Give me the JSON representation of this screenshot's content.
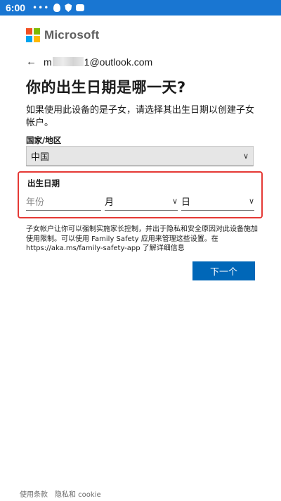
{
  "status_bar": {
    "time": "6:00"
  },
  "brand": {
    "name": "Microsoft",
    "colors": {
      "red": "#f25022",
      "green": "#7fba00",
      "blue": "#00a4ef",
      "yellow": "#ffb900"
    }
  },
  "account": {
    "email_prefix": "m",
    "email_suffix": "1@outlook.com"
  },
  "page": {
    "title": "你的出生日期是哪一天?",
    "description": "如果使用此设备的是子女，请选择其出生日期以创建子女帐户。"
  },
  "country": {
    "label": "国家/地区",
    "value": "中国"
  },
  "birth_date": {
    "label": "出生日期",
    "year_placeholder": "年份",
    "month_placeholder": "月",
    "day_placeholder": "日"
  },
  "info_text": "子女帐户让你可以强制实施家长控制，并出于隐私和安全原因对此设备施加使用限制。可以使用 Family Safety 应用来管理这些设置。在 https://aka.ms/family-safety-app 了解详细信息",
  "actions": {
    "next_label": "下一个"
  },
  "footer": {
    "terms": "使用条款",
    "privacy": "隐私和 cookie"
  },
  "colors": {
    "accent": "#0067b8",
    "status_bar": "#1976d2",
    "highlight": "#e53935"
  }
}
